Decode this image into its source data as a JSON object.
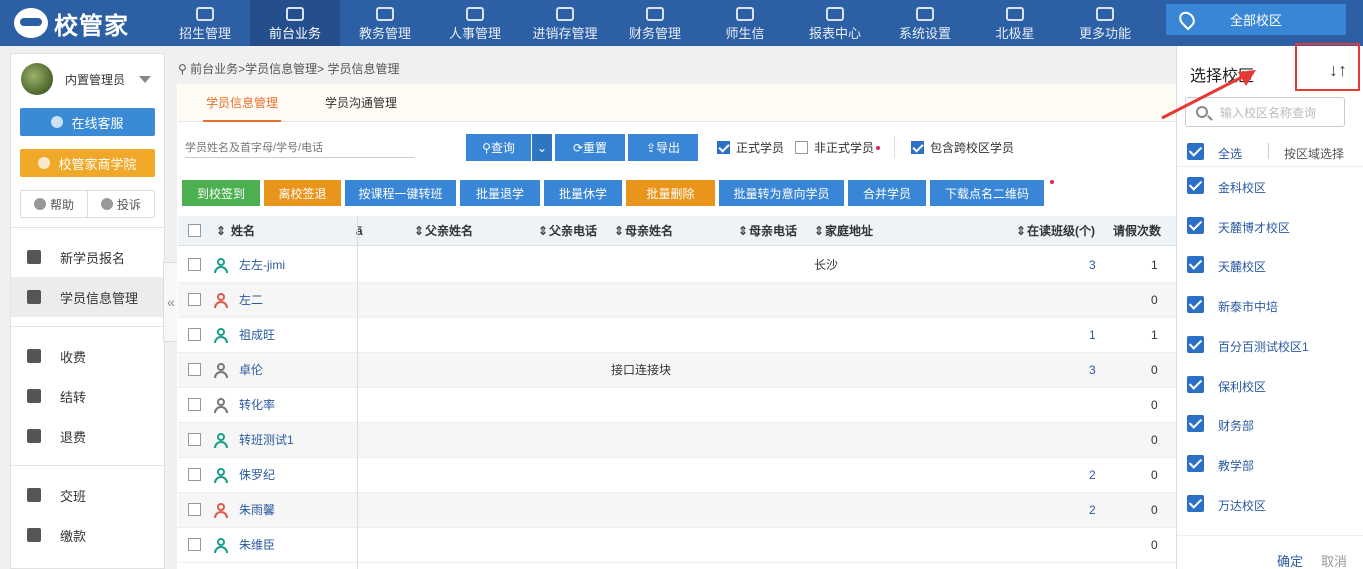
{
  "brand": {
    "name": "校管家"
  },
  "nav": {
    "items": [
      {
        "label": "招生管理",
        "active": false
      },
      {
        "label": "前台业务",
        "active": true
      },
      {
        "label": "教务管理",
        "active": false
      },
      {
        "label": "人事管理",
        "active": false
      },
      {
        "label": "进销存管理",
        "active": false
      },
      {
        "label": "财务管理",
        "active": false
      },
      {
        "label": "师生信",
        "active": false
      },
      {
        "label": "报表中心",
        "active": false
      },
      {
        "label": "系统设置",
        "active": false
      },
      {
        "label": "北极星",
        "active": false
      },
      {
        "label": "更多功能",
        "active": false
      }
    ],
    "campus_button": "全部校区"
  },
  "sidebar": {
    "user_name": "内置管理员",
    "online_service": "在线客服",
    "academy": "校管家商学院",
    "help": "帮助",
    "complaint": "投诉",
    "menu": [
      {
        "label": "新学员报名",
        "active": false,
        "icon": "graduation-cap-icon"
      },
      {
        "label": "学员信息管理",
        "active": true,
        "icon": "id-card-icon"
      },
      {
        "label": "收费",
        "active": false,
        "icon": "wallet-icon"
      },
      {
        "label": "结转",
        "active": false,
        "icon": "transfer-icon"
      },
      {
        "label": "退费",
        "active": false,
        "icon": "refund-icon"
      },
      {
        "label": "交班",
        "active": false,
        "icon": "handover-icon"
      },
      {
        "label": "缴款",
        "active": false,
        "icon": "payment-icon"
      }
    ],
    "collapse_glyph": "«"
  },
  "breadcrumb": "前台业务>学员信息管理> 学员信息管理",
  "tabs": [
    "学员信息管理",
    "学员沟通管理"
  ],
  "filters": {
    "search_placeholder": "学员姓名及首字母/学号/电话",
    "query": "查询",
    "reset": "重置",
    "export": "导出",
    "formal": "正式学员",
    "informal": "非正式学员",
    "include_cross": "包含跨校区学员"
  },
  "actions": [
    "到校签到",
    "离校签退",
    "按课程一键转班",
    "批量退学",
    "批量休学",
    "批量删除",
    "批量转为意向学员",
    "合并学员",
    "下载点名二维码"
  ],
  "table": {
    "headers": {
      "name": "姓名",
      "father_name": "父亲姓名",
      "father_phone": "父亲电话",
      "mother_name": "母亲姓名",
      "mother_phone": "母亲电话",
      "address": "家庭地址",
      "classes": "在读班级(个)",
      "leave": "请假次数"
    },
    "rows": [
      {
        "name": "左左-jimi",
        "gender": "male",
        "address": "长沙",
        "note": "",
        "classes": "3",
        "leave": "1"
      },
      {
        "name": "左二",
        "gender": "female",
        "address": "",
        "note": "",
        "classes": "",
        "leave": "0"
      },
      {
        "name": "祖成旺",
        "gender": "male",
        "address": "",
        "note": "",
        "classes": "1",
        "leave": "1"
      },
      {
        "name": "卓伦",
        "gender": "unknown",
        "address": "",
        "note": "接口连接块",
        "classes": "3",
        "leave": "0"
      },
      {
        "name": "转化率",
        "gender": "unknown",
        "address": "",
        "note": "",
        "classes": "",
        "leave": "0"
      },
      {
        "name": "转班测试1",
        "gender": "male",
        "address": "",
        "note": "",
        "classes": "",
        "leave": "0"
      },
      {
        "name": "侏罗纪",
        "gender": "male",
        "address": "",
        "note": "",
        "classes": "2",
        "leave": "0"
      },
      {
        "name": "朱雨馨",
        "gender": "female",
        "address": "",
        "note": "",
        "classes": "2",
        "leave": "0"
      },
      {
        "name": "朱维臣",
        "gender": "male",
        "address": "",
        "note": "",
        "classes": "",
        "leave": "0"
      }
    ]
  },
  "panel": {
    "title": "选择校区",
    "search_placeholder": "输入校区名称查询",
    "select_all": "全选",
    "by_region": "按区域选择",
    "campuses": [
      "金科校区",
      "天麓博才校区",
      "天麓校区",
      "新泰市中培",
      "百分百测试校区1",
      "保利校区",
      "财务部",
      "教学部",
      "万达校区"
    ],
    "confirm": "确定",
    "cancel": "取消"
  },
  "colors": {
    "nav": "#2c5fa3",
    "accent_blue": "#3a86d6",
    "orange": "#e9951c",
    "green": "#4caf50",
    "male": "#1a9e8a",
    "female": "#e05a4b",
    "unknown": "#777777",
    "annotation_red": "#e53935"
  }
}
